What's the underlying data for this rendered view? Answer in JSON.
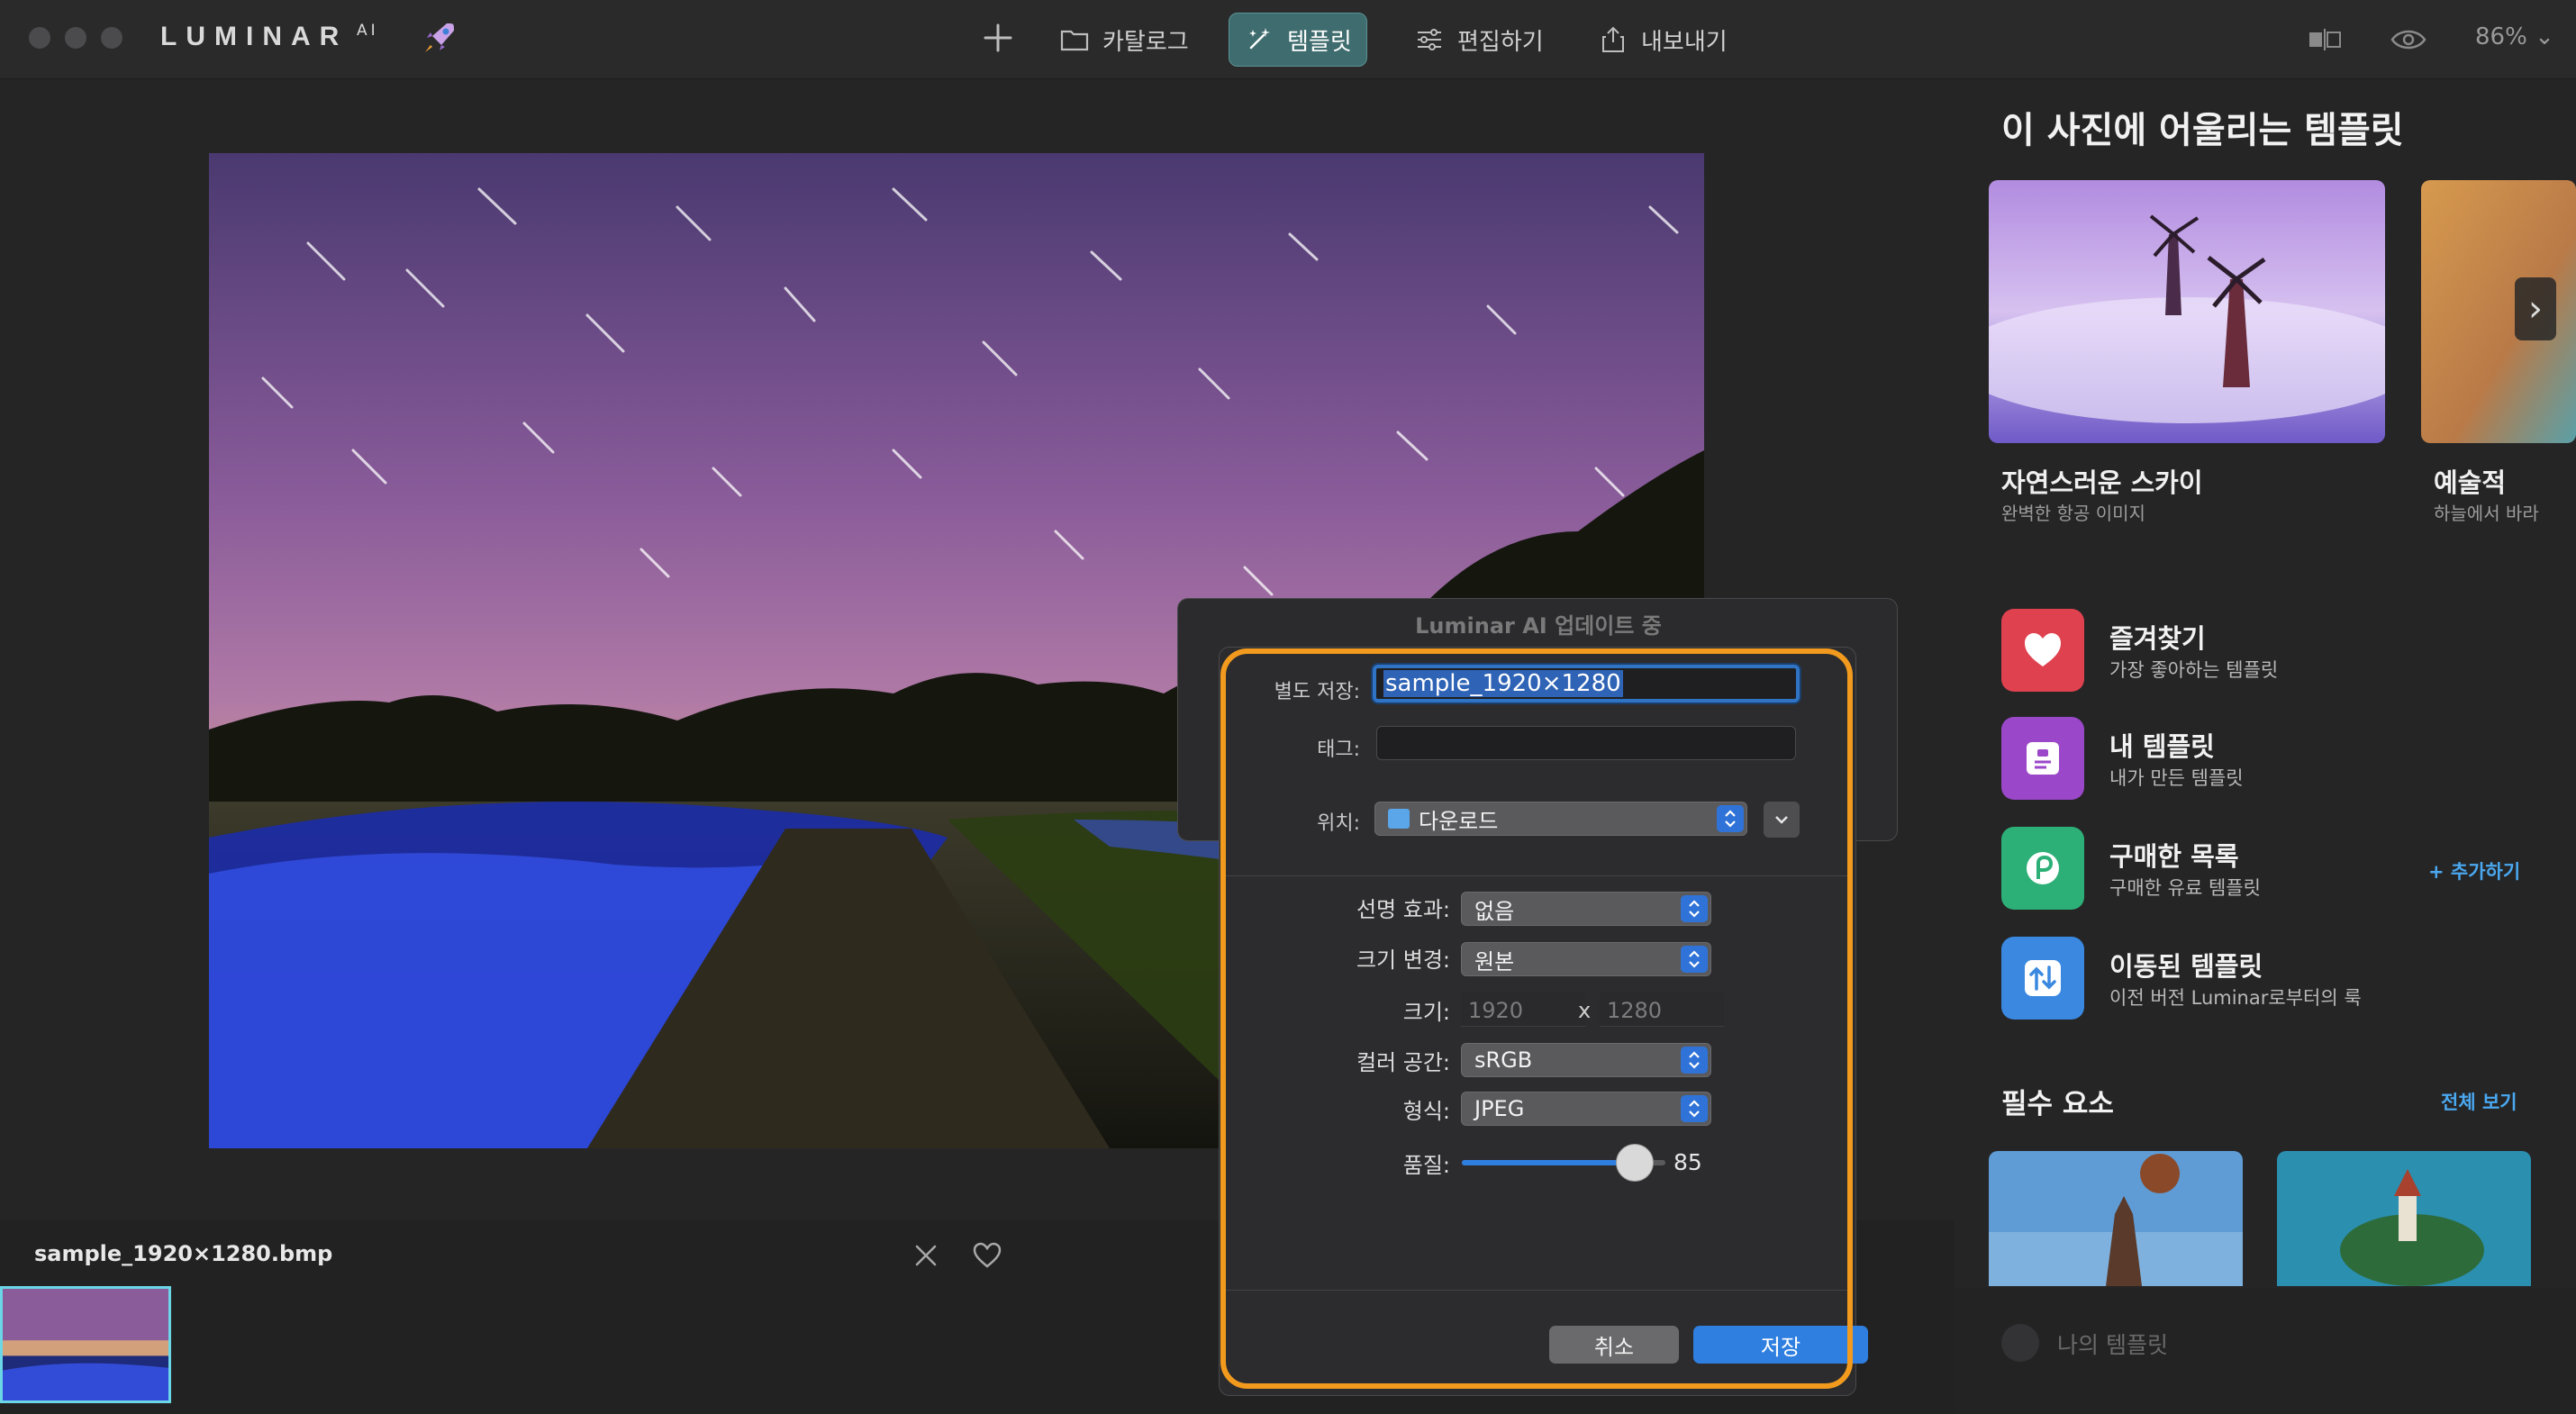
{
  "app": {
    "logo": "LUMINAR",
    "logo_suffix": "AI",
    "zoom": "86%"
  },
  "nav": {
    "catalog": "카탈로그",
    "templates": "템플릿",
    "edit": "편집하기",
    "export": "내보내기"
  },
  "filmstrip": {
    "filename": "sample_1920×1280.bmp"
  },
  "right_panel": {
    "title": "이 사진에 어울리는 템플릿",
    "templates": [
      {
        "name": "자연스러운 스카이",
        "sub": "완벽한 항공 이미지"
      },
      {
        "name": "예술적",
        "sub": "하늘에서 바라"
      }
    ],
    "categories": [
      {
        "title": "즐겨찾기",
        "sub": "가장 좋아하는 템플릿",
        "color": "#e0414f",
        "icon": "heart-icon"
      },
      {
        "title": "내 템플릿",
        "sub": "내가 만든 템플릿",
        "color": "#9a48c9",
        "icon": "document-icon"
      },
      {
        "title": "구매한 목록",
        "sub": "구매한 유료 템플릿",
        "color": "#2db077",
        "icon": "purchase-icon"
      },
      {
        "title": "이동된 템플릿",
        "sub": "이전 버전 Luminar로부터의 룩",
        "color": "#3a88e0",
        "icon": "transfer-icon"
      }
    ],
    "add_link": "+ 추가하기",
    "essentials_title": "필수 요소",
    "see_all": "전체 보기",
    "my_templates": "나의 템플릿"
  },
  "sheet": {
    "title": "Luminar AI 업데이트 중"
  },
  "dialog": {
    "save_as_label": "별도 저장:",
    "save_as_value": "sample_1920×1280",
    "tags_label": "태그:",
    "tags_value": "",
    "where_label": "위치:",
    "where_value": "다운로드",
    "sharpen_label": "선명 효과:",
    "sharpen_value": "없음",
    "resize_label": "크기 변경:",
    "resize_value": "원본",
    "size_label": "크기:",
    "width_value": "1920",
    "size_separator": "x",
    "height_value": "1280",
    "colorspace_label": "컬러 공간:",
    "colorspace_value": "sRGB",
    "format_label": "형식:",
    "format_value": "JPEG",
    "quality_label": "품질:",
    "quality_value": "85",
    "quality_fraction": 0.85,
    "cancel": "취소",
    "save": "저장"
  },
  "colors": {
    "accent_blue": "#2f7fe0",
    "highlight_orange": "#f29a1e",
    "nav_active": "#3f6c6e"
  }
}
